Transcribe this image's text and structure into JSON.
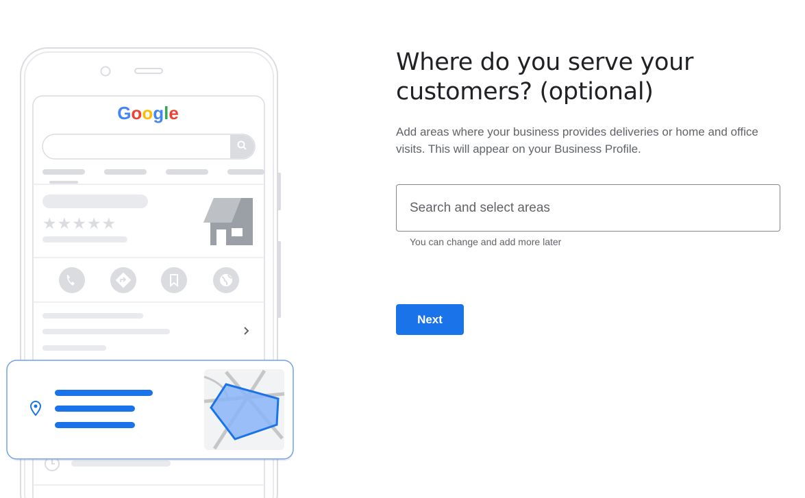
{
  "form": {
    "title": "Where do you serve your customers? (optional)",
    "description": "Add areas where your business provides deliveries or home and office visits. This will appear on your Business Profile.",
    "search_placeholder": "Search and select areas",
    "search_value": "",
    "helper_text": "You can change and add more later",
    "next_label": "Next"
  },
  "illustration": {
    "brand_text": "Google",
    "icons": [
      "phone-icon",
      "directions-icon",
      "bookmark-icon",
      "website-globe-icon",
      "location-pin-icon",
      "clock-icon",
      "chevron-right-icon",
      "search-icon",
      "storefront-icon",
      "star-icon"
    ],
    "colors": {
      "accent": "#1a73e8",
      "outline": "#dadce0",
      "placeholder_bar": "#e8eaed",
      "icon_grey": "#dadce0",
      "area_fill": "#8ab4f8"
    }
  }
}
